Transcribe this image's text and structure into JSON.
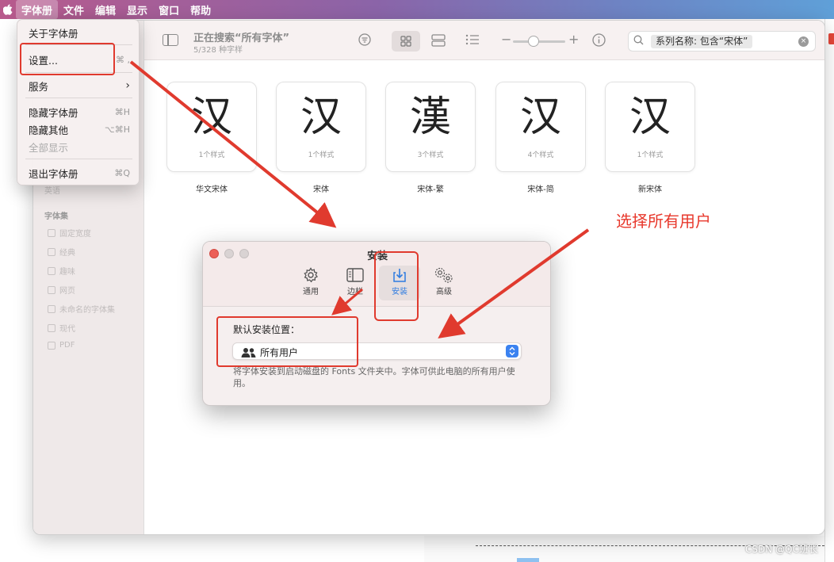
{
  "menubar": {
    "apple": "",
    "items": [
      "字体册",
      "文件",
      "编辑",
      "显示",
      "窗口",
      "帮助"
    ]
  },
  "app_menu": {
    "about": "关于字体册",
    "settings": "设置...",
    "settings_shortcut": "⌘ ,",
    "services": "服务",
    "services_arrow": "›",
    "hide": "隐藏字体册",
    "hide_shortcut": "⌘H",
    "hide_others": "隐藏其他",
    "hide_others_shortcut": "⌥⌘H",
    "show_all": "全部显示",
    "quit": "退出字体册",
    "quit_shortcut": "⌘Q"
  },
  "toolbar": {
    "title": "正在搜索“所有字体”",
    "subtitle": "5/328 种字样",
    "search_token": "系列名称: 包含“宋体”",
    "clear": "×"
  },
  "sidebar": {
    "ghost_item": "英语",
    "section_label": "字体集",
    "collections": [
      "固定宽度",
      "经典",
      "趣味",
      "网页",
      "未命名的字体集",
      "现代",
      "PDF"
    ]
  },
  "fonts": [
    {
      "glyph": "汉",
      "styles": "1个样式",
      "name": "华文宋体"
    },
    {
      "glyph": "汉",
      "styles": "1个样式",
      "name": "宋体"
    },
    {
      "glyph": "漢",
      "styles": "3个样式",
      "name": "宋体-繁"
    },
    {
      "glyph": "汉",
      "styles": "4个样式",
      "name": "宋体-简"
    },
    {
      "glyph": "汉",
      "styles": "1个样式",
      "name": "新宋体"
    }
  ],
  "dialog": {
    "title": "安装",
    "tabs": [
      {
        "label": "通用",
        "icon": "gear-icon"
      },
      {
        "label": "边栏",
        "icon": "sidebar-icon"
      },
      {
        "label": "安装",
        "icon": "download-icon"
      },
      {
        "label": "高级",
        "icon": "gears-icon"
      }
    ],
    "selected_tab": "安装",
    "location_label": "默认安装位置：",
    "location_value": "所有用户",
    "description": "将字体安装到启动磁盘的 Fonts 文件夹中。字体可供此电脑的所有用户使用。"
  },
  "annotation": {
    "text": "选择所有用户",
    "color": "#e8382c"
  },
  "watermark": "CSDN @QC班长"
}
